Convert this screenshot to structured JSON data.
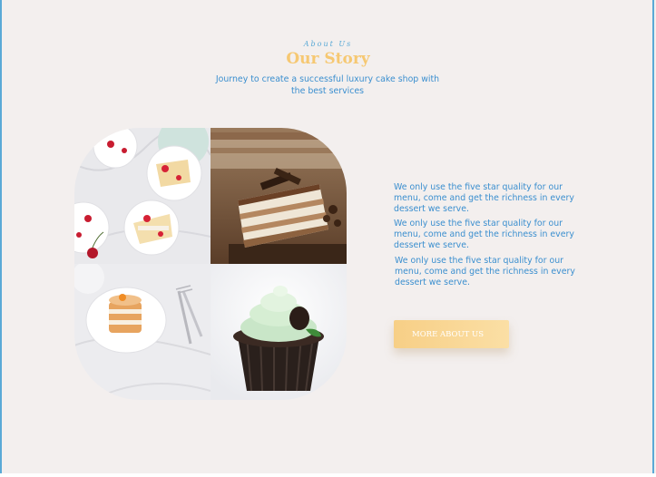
{
  "section": {
    "eyebrow": "About Us",
    "title": "Our Story",
    "subtitle": "Journey to create a successful luxury cake shop with the best services"
  },
  "gallery": {
    "images": [
      {
        "name": "cherry-cake-plates-image"
      },
      {
        "name": "tiramisu-slice-image"
      },
      {
        "name": "mini-layer-cake-image"
      },
      {
        "name": "mint-cupcake-image"
      }
    ]
  },
  "description": {
    "paragraphs": [
      "We only use the five star quality for our menu, come and get the richness in every dessert we serve.",
      "We only use the five star quality for our menu, come and get the richness in every dessert we serve.",
      "We only use the five star quality for our menu, come and get the richness in every dessert we serve."
    ]
  },
  "cta": {
    "label": "MORE ABOUT US"
  },
  "colors": {
    "background": "#f3efee",
    "accent_gold": "#f6c872",
    "text_blue": "#3b8fcf",
    "button_gradient_start": "#f7cf86",
    "button_gradient_end": "#fbdfa5"
  }
}
